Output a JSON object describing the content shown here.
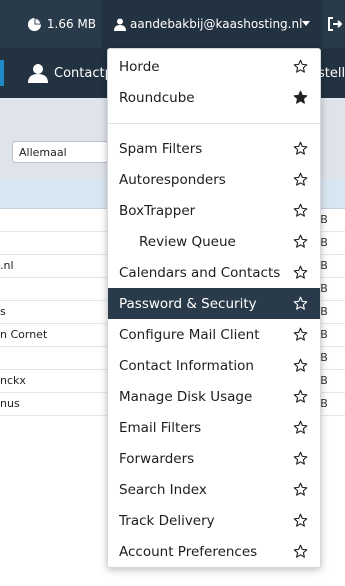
{
  "topbar": {
    "disk_usage": "1.66 MB",
    "user_email": "aandebakbij@kaashosting.nl"
  },
  "navbar": {
    "contact_label": "Contactp",
    "right_label": "stelli"
  },
  "filter": {
    "select_value": "Allemaal"
  },
  "table": {
    "header_partial": "e",
    "rows": [
      {
        "name": "",
        "kb": "KB"
      },
      {
        "name": "",
        "kb": "KB"
      },
      {
        "name": ".nl",
        "kb": "KB"
      },
      {
        "name": "",
        "kb": "KB"
      },
      {
        "name": "s",
        "kb": "KB"
      },
      {
        "name": "n Cornet",
        "kb": "KB"
      },
      {
        "name": "",
        "kb": "KB"
      },
      {
        "name": "nckx",
        "kb": "KB"
      },
      {
        "name": "nus",
        "kb": "KB"
      }
    ]
  },
  "menu": {
    "group1": [
      {
        "label": "Horde",
        "starred": false
      },
      {
        "label": "Roundcube",
        "starred": true
      }
    ],
    "group2": [
      {
        "label": "Spam Filters",
        "starred": false
      },
      {
        "label": "Autoresponders",
        "starred": false
      },
      {
        "label": "BoxTrapper",
        "starred": false
      },
      {
        "label": "Review Queue",
        "starred": false,
        "sub": true
      },
      {
        "label": "Calendars and Contacts",
        "starred": false
      },
      {
        "label": "Password & Security",
        "starred": false,
        "active": true
      },
      {
        "label": "Configure Mail Client",
        "starred": false
      },
      {
        "label": "Contact Information",
        "starred": false
      },
      {
        "label": "Manage Disk Usage",
        "starred": false
      },
      {
        "label": "Email Filters",
        "starred": false
      },
      {
        "label": "Forwarders",
        "starred": false
      },
      {
        "label": "Search Index",
        "starred": false
      },
      {
        "label": "Track Delivery",
        "starred": false
      },
      {
        "label": "Account Preferences",
        "starred": false
      }
    ]
  },
  "colors": {
    "topbar": "#293a4a",
    "active_item": "#293a4a",
    "accent": "#1f8ac6"
  }
}
